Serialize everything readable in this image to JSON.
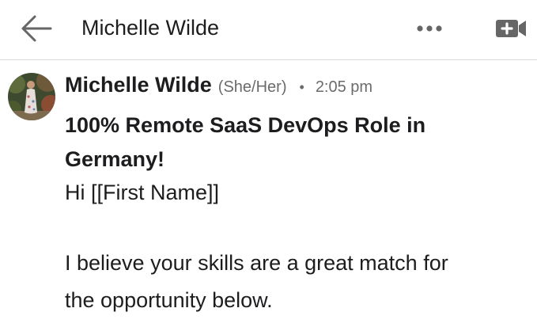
{
  "header": {
    "back_icon": "arrow-left-icon",
    "title": "Michelle Wilde",
    "more_icon": "ellipsis-icon",
    "video_icon": "video-call-icon"
  },
  "message": {
    "avatar_alt": "Michelle Wilde profile photo",
    "sender_name": "Michelle Wilde",
    "pronouns": "(She/Her)",
    "separator": "•",
    "timestamp": "2:05 pm",
    "subject": "100% Remote SaaS DevOps Role in Germany!",
    "body_lines": [
      "Hi [[First Name]]",
      "I believe your skills are a great match for",
      "the opportunity below."
    ]
  },
  "colors": {
    "text": "#1d1d1f",
    "muted": "#6b6b6b",
    "divider": "#d9d9d9",
    "icon": "#666666"
  }
}
